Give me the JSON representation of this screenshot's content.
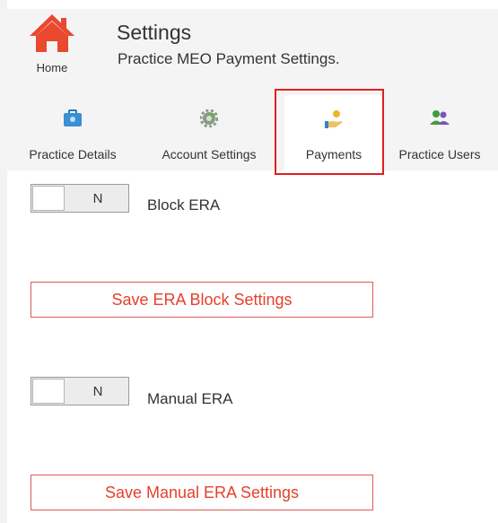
{
  "header": {
    "home_label": "Home",
    "title": "Settings",
    "subtitle": "Practice MEO Payment Settings."
  },
  "tabs": [
    {
      "label": "Practice Details",
      "icon": "briefcase-icon",
      "active": false
    },
    {
      "label": "Account Settings",
      "icon": "gear-icon",
      "active": false
    },
    {
      "label": "Payments",
      "icon": "hand-coin-icon",
      "active": true
    },
    {
      "label": "Practice Users",
      "icon": "users-icon",
      "active": false
    }
  ],
  "block_era": {
    "toggle_value": "N",
    "label": "Block ERA",
    "save_label": "Save ERA Block Settings"
  },
  "manual_era": {
    "toggle_value": "N",
    "label": "Manual ERA",
    "save_label": "Save Manual ERA Settings"
  },
  "colors": {
    "home_icon": "#e8492f",
    "accent_red": "#e5402b",
    "active_tab_outline": "#e02020"
  }
}
